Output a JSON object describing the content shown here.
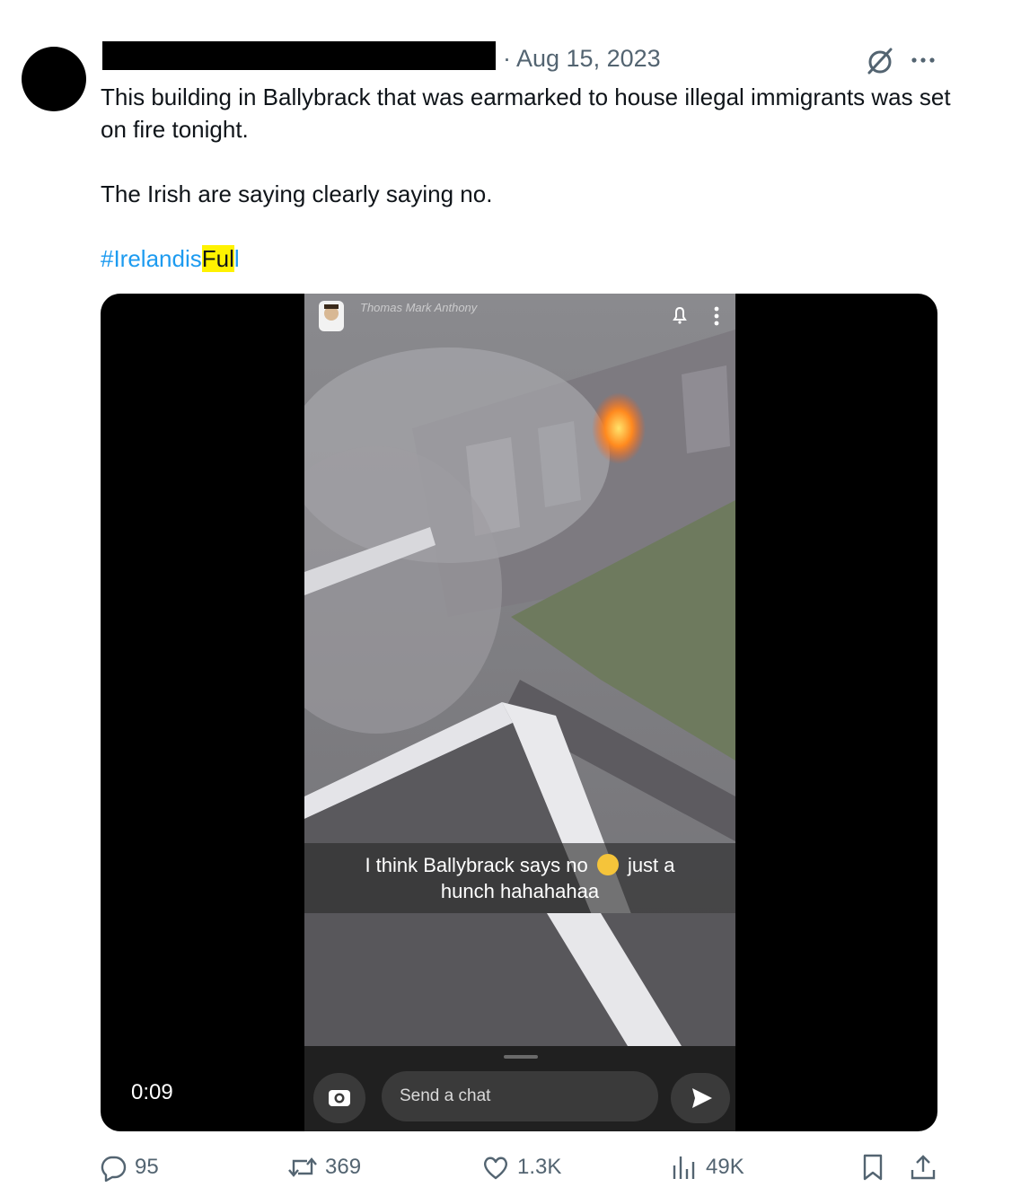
{
  "tweet": {
    "date": "· Aug 15, 2023",
    "text_line1": "This building in Ballybrack that was earmarked to house illegal immigrants was set on fire tonight.",
    "text_line2": "The Irish are saying clearly saying no.",
    "hashtag_prefix": "#Irelandis",
    "hashtag_highlight": "Ful",
    "hashtag_suffix": "l"
  },
  "video": {
    "timestamp": "0:09",
    "snap_username": "Thomas Mark Anthony",
    "caption_part1": "I think Ballybrack says no",
    "caption_part2": "just a",
    "caption_line2": "hunch hahahahaa",
    "chat_placeholder": "Send a chat"
  },
  "actions": {
    "replies": "95",
    "reposts": "369",
    "likes": "1.3K",
    "views": "49K"
  },
  "icons": {
    "reply": "reply-icon",
    "repost": "repost-icon",
    "like": "heart-icon",
    "views": "views-icon",
    "bookmark": "bookmark-icon",
    "share": "share-icon",
    "grok": "grok-icon",
    "more": "more-icon"
  },
  "colors": {
    "accent": "#1d9bf0",
    "secondary_text": "#536471",
    "highlight": "#fff200"
  }
}
